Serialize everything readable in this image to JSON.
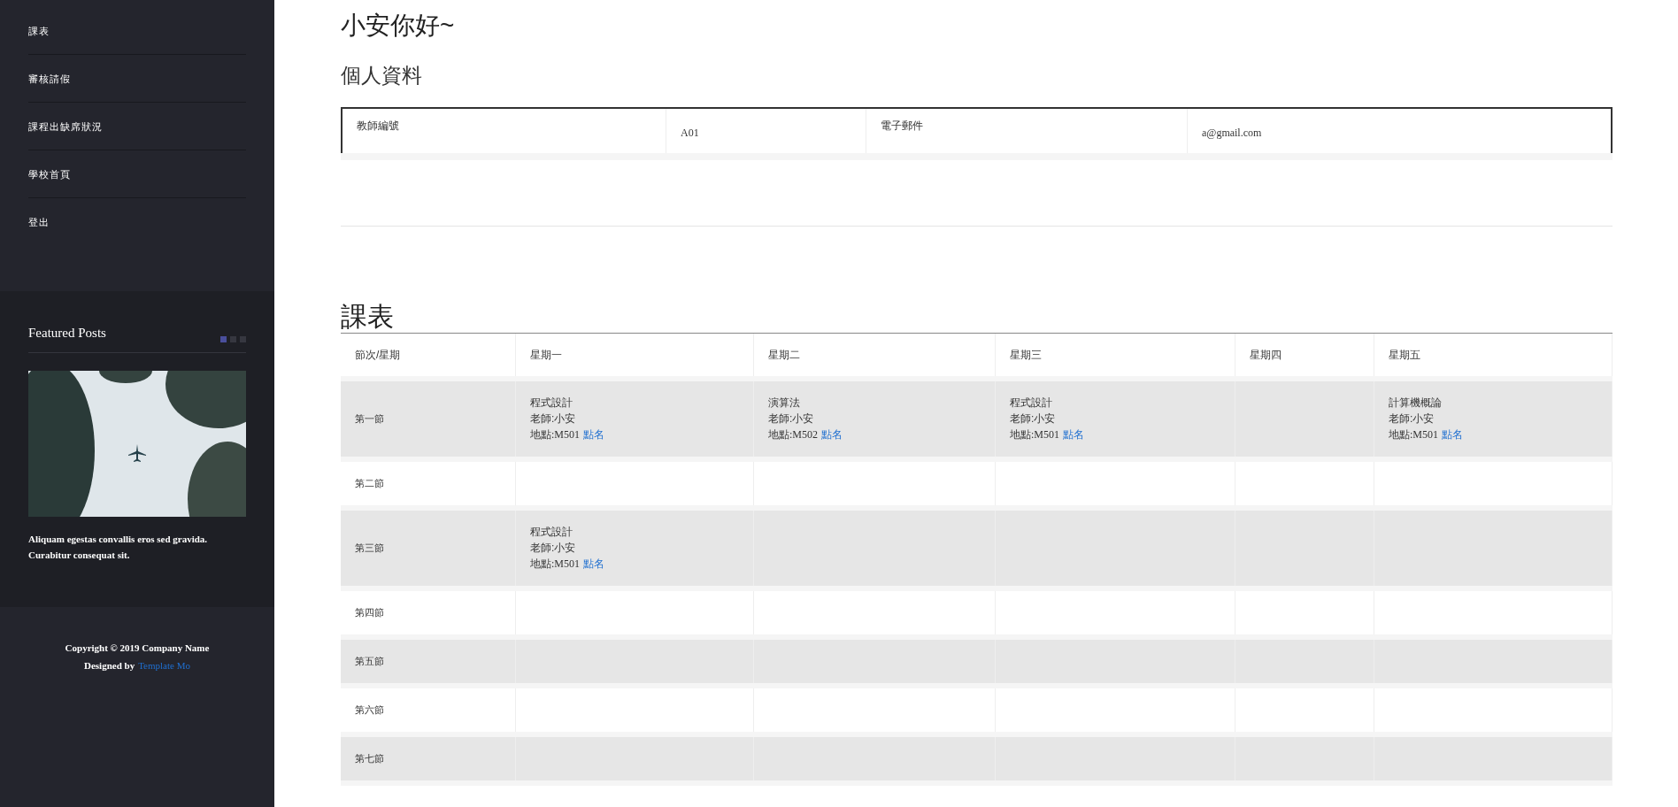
{
  "sidebar": {
    "nav": [
      {
        "label": "課表"
      },
      {
        "label": "審核請假"
      },
      {
        "label": "課程出缺席狀況"
      },
      {
        "label": "學校首頁"
      },
      {
        "label": "登出"
      }
    ],
    "featured": {
      "title": "Featured Posts",
      "dots": [
        {
          "selected": true
        },
        {
          "selected": false
        },
        {
          "selected": false
        }
      ],
      "caption": "Aliquam egestas convallis eros sed gravida. Curabitur consequat sit."
    },
    "footer": {
      "copyright": "Copyright © 2019 Company Name",
      "designed_by": "Designed by",
      "link": "Template Mo"
    }
  },
  "greeting": "小安你好~",
  "profile": {
    "title": "個人資料",
    "fields": [
      {
        "label": "教師編號",
        "value": "A01"
      },
      {
        "label": "電子郵件",
        "value": "a@gmail.com"
      }
    ]
  },
  "schedule": {
    "title": "課表",
    "columns": [
      "節次/星期",
      "星期一",
      "星期二",
      "星期三",
      "星期四",
      "星期五"
    ],
    "rows": [
      {
        "cells": [
          {
            "kind": "label",
            "text": "第一節"
          },
          {
            "kind": "class",
            "course": "程式設計",
            "teacher": "老師:小安",
            "place": "地點:M501",
            "link": "點名"
          },
          {
            "kind": "class",
            "course": "演算法",
            "teacher": "老師:小安",
            "place": "地點:M502",
            "link": "點名"
          },
          {
            "kind": "class",
            "course": "程式設計",
            "teacher": "老師:小安",
            "place": "地點:M501",
            "link": "點名"
          },
          {
            "kind": "empty"
          },
          {
            "kind": "class",
            "course": "計算機概論",
            "teacher": "老師:小安",
            "place": "地點:M501",
            "link": "點名"
          }
        ]
      },
      {
        "cells": [
          {
            "kind": "label",
            "text": "第二節"
          },
          {
            "kind": "empty"
          },
          {
            "kind": "empty"
          },
          {
            "kind": "empty"
          },
          {
            "kind": "empty"
          },
          {
            "kind": "empty"
          }
        ]
      },
      {
        "cells": [
          {
            "kind": "label",
            "text": "第三節"
          },
          {
            "kind": "class",
            "course": "程式設計",
            "teacher": "老師:小安",
            "place": "地點:M501",
            "link": "點名"
          },
          {
            "kind": "empty"
          },
          {
            "kind": "empty"
          },
          {
            "kind": "empty"
          },
          {
            "kind": "empty"
          }
        ]
      },
      {
        "cells": [
          {
            "kind": "label",
            "text": "第四節"
          },
          {
            "kind": "empty"
          },
          {
            "kind": "empty"
          },
          {
            "kind": "empty"
          },
          {
            "kind": "empty"
          },
          {
            "kind": "empty"
          }
        ]
      },
      {
        "cells": [
          {
            "kind": "label",
            "text": "第五節"
          },
          {
            "kind": "empty"
          },
          {
            "kind": "empty"
          },
          {
            "kind": "empty"
          },
          {
            "kind": "empty"
          },
          {
            "kind": "empty"
          }
        ]
      },
      {
        "cells": [
          {
            "kind": "label",
            "text": "第六節"
          },
          {
            "kind": "empty"
          },
          {
            "kind": "empty"
          },
          {
            "kind": "empty"
          },
          {
            "kind": "empty"
          },
          {
            "kind": "empty"
          }
        ]
      },
      {
        "cells": [
          {
            "kind": "label",
            "text": "第七節"
          },
          {
            "kind": "empty"
          },
          {
            "kind": "empty"
          },
          {
            "kind": "empty"
          },
          {
            "kind": "empty"
          },
          {
            "kind": "empty"
          }
        ]
      }
    ]
  }
}
